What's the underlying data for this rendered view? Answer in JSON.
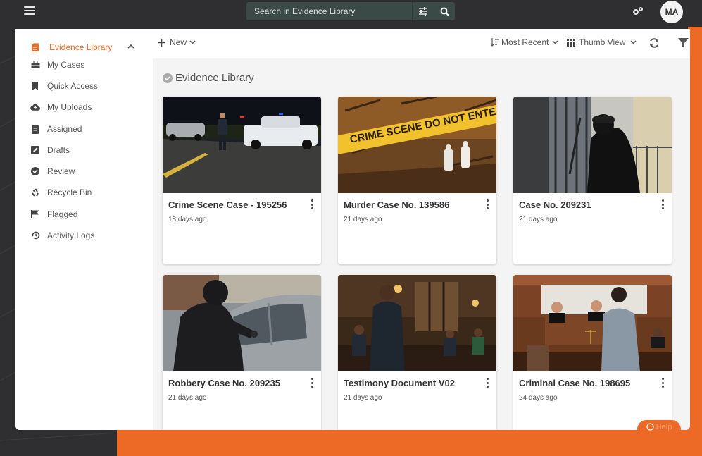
{
  "topbar": {
    "search_placeholder": "Search in Evidence Library",
    "avatar_initials": "MA"
  },
  "sidebar": {
    "items": [
      {
        "label": "Evidence Library",
        "icon": "library-icon",
        "active": true
      },
      {
        "label": "My Cases",
        "icon": "briefcase-icon"
      },
      {
        "label": "Quick Access",
        "icon": "bookmark-icon"
      },
      {
        "label": "My Uploads",
        "icon": "cloud-upload-icon"
      },
      {
        "label": "Assigned",
        "icon": "assignment-icon"
      },
      {
        "label": "Drafts",
        "icon": "edit-icon"
      },
      {
        "label": "Review",
        "icon": "check-circle-icon"
      },
      {
        "label": "Recycle Bin",
        "icon": "recycle-icon"
      },
      {
        "label": "Flagged",
        "icon": "flag-icon"
      },
      {
        "label": "Activity Logs",
        "icon": "history-icon"
      }
    ]
  },
  "toolbar": {
    "new_label": "New",
    "sort_label": "Most Recent",
    "view_label": "Thumb View"
  },
  "content": {
    "title": "Evidence Library",
    "cards": [
      {
        "title": "Crime Scene Case - 195256",
        "date": "18 days ago",
        "image": "night-traffic-stop"
      },
      {
        "title": "Murder Case No. 139586",
        "date": "21 days ago",
        "image": "crime-scene-tape",
        "tape_text": "CRIME SCENE DO NOT ENTER"
      },
      {
        "title": "Case No. 209231",
        "date": "21 days ago",
        "image": "burglar-at-door"
      },
      {
        "title": "Robbery Case No. 209235",
        "date": "21 days ago",
        "image": "car-thief"
      },
      {
        "title": "Testimony Document V02",
        "date": "21 days ago",
        "image": "courtroom-testimony"
      },
      {
        "title": "Criminal Case No. 198695",
        "date": "24 days ago",
        "image": "courtroom-judges"
      }
    ]
  },
  "help": {
    "label": "Help"
  },
  "colors": {
    "accent": "#ec6a25",
    "topbar": "#2f2f31",
    "search_bg": "#3c4a47"
  }
}
